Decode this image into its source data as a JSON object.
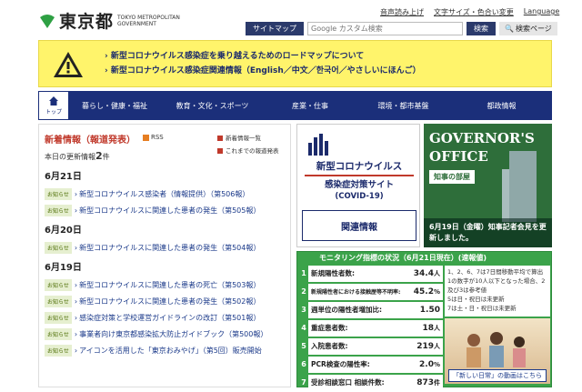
{
  "header": {
    "logo_jp": "東京都",
    "logo_en_1": "TOKYO METROPOLITAN",
    "logo_en_2": "GOVERNMENT",
    "util_links": [
      "音声読み上げ",
      "文字サイズ・色合い変更",
      "Language"
    ],
    "sitemap": "サイトマップ",
    "search_placeholder": "Google カスタム検索",
    "search_button": "検索",
    "search_page": "検索ページ"
  },
  "alert": {
    "lines": [
      "新型コロナウイルス感染症を乗り越えるためのロードマップについて",
      "新型コロナウイルス感染症関連情報（English／中文／한국어／やさしいにほんご）"
    ]
  },
  "nav": {
    "top": "トップ",
    "items": [
      "暮らし・健康・福祉",
      "教育・文化・スポーツ",
      "産業・仕事",
      "環境・都市基盤",
      "都政情報"
    ]
  },
  "news": {
    "title": "新着情報（報道発表）",
    "rss": "RSS",
    "links": [
      "新着情報一覧",
      "これまでの報道発表"
    ],
    "today_label": "本日の更新情報",
    "today_count": "2",
    "today_unit": "件",
    "groups": [
      {
        "date": "6月21日",
        "items": [
          {
            "tag": "お知らせ",
            "text": "新型コロナウイルス感染者（情報提供）（第506報）"
          },
          {
            "tag": "お知らせ",
            "text": "新型コロナウイルスに関連した患者の発生（第505報）"
          }
        ]
      },
      {
        "date": "6月20日",
        "items": [
          {
            "tag": "お知らせ",
            "text": "新型コロナウイルスに関連した患者の発生（第504報）"
          }
        ]
      },
      {
        "date": "6月19日",
        "items": [
          {
            "tag": "お知らせ",
            "text": "新型コロナウイルスに関連した患者の死亡（第503報）"
          },
          {
            "tag": "お知らせ",
            "text": "新型コロナウイルスに関連した患者の発生（第502報）"
          },
          {
            "tag": "お知らせ",
            "text": "感染症対策と学校運営ガイドラインの改訂（第501報）"
          },
          {
            "tag": "お知らせ",
            "text": "事業者向け東京都感染拡大防止ガイドブック（第500報）"
          },
          {
            "tag": "お知らせ",
            "text": "アイコンを活用した「東京おみやげ」（第5回）販売開始"
          }
        ]
      }
    ]
  },
  "covid": {
    "title1": "新型コロナウイルス",
    "title2": "感染症対策サイト",
    "title3": "(COVID-19)",
    "related": "関連情報"
  },
  "governor": {
    "title1": "GOVERNOR'S",
    "title2": "OFFICE",
    "room": "知事の部屋",
    "caption": "6月19日（金曜）知事記者会見を更新しました。"
  },
  "monitoring": {
    "head": "モニタリング指標の状況（6月21日現在）(速報値)",
    "rows": [
      {
        "n": "1",
        "label": "新規陽性者数:",
        "value": "34.4",
        "unit": "人"
      },
      {
        "n": "2",
        "label": "新規陽性者における接触歴等不明率:",
        "value": "45.2",
        "unit": "%"
      },
      {
        "n": "3",
        "label": "週単位の陽性者増加比:",
        "value": "1.50",
        "unit": ""
      },
      {
        "n": "4",
        "label": "重症患者数:",
        "value": "18",
        "unit": "人"
      },
      {
        "n": "5",
        "label": "入院患者数:",
        "value": "219",
        "unit": "人"
      },
      {
        "n": "6",
        "label": "PCR検査の陽性率:",
        "value": "2.0",
        "unit": "%"
      },
      {
        "n": "7",
        "label": "受診相談窓口 相談件数:",
        "value": "873",
        "unit": "件"
      }
    ],
    "legend": [
      "1、2、6、7は7日間移動平均で算出",
      "1の数字が10人以下となった場合、2及び3は参考値",
      "5は日・祝日は未更新",
      "7は土・日・祝日は未更新"
    ],
    "cta": "「新しい日常」の動画はこちら"
  },
  "colors": {
    "nav": "#1b2f7a",
    "alert": "#fff46b",
    "monitoring": "#3ba34a",
    "governor": "#2e6e3a"
  }
}
